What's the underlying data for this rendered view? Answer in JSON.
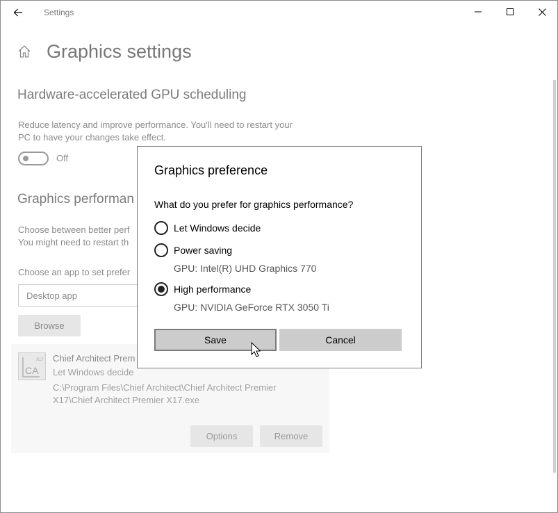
{
  "window": {
    "title": "Settings",
    "back_icon": "back-arrow-icon",
    "controls": [
      "minimize-icon",
      "maximize-icon",
      "close-icon"
    ]
  },
  "page": {
    "home_icon": "home-icon",
    "title": "Graphics settings",
    "hags": {
      "title": "Hardware-accelerated GPU scheduling",
      "description_line1": "Reduce latency and improve performance. You'll need to restart your",
      "description_line2": "PC to have your changes take effect.",
      "toggle_state": "Off"
    },
    "perf": {
      "title": "Graphics performan",
      "description_line1": "Choose between better perf",
      "description_line2": "You might need to restart th",
      "choose_label": "Choose an app to set prefer",
      "select_value": "Desktop app",
      "browse_label": "Browse"
    },
    "app": {
      "name": "Chief Architect Prem",
      "preference": "Let Windows decide",
      "path_line1": "C:\\Program Files\\Chief Architect\\Chief Architect Premier",
      "path_line2": "X17\\Chief Architect Premier X17.exe",
      "options_label": "Options",
      "remove_label": "Remove"
    }
  },
  "dialog": {
    "title": "Graphics preference",
    "question": "What do you prefer for graphics performance?",
    "options": [
      {
        "label": "Let Windows decide",
        "selected": false
      },
      {
        "label": "Power saving",
        "selected": false,
        "gpu": "GPU: Intel(R) UHD Graphics 770"
      },
      {
        "label": "High performance",
        "selected": true,
        "gpu": "GPU: NVIDIA GeForce RTX 3050 Ti"
      }
    ],
    "save_label": "Save",
    "cancel_label": "Cancel"
  }
}
